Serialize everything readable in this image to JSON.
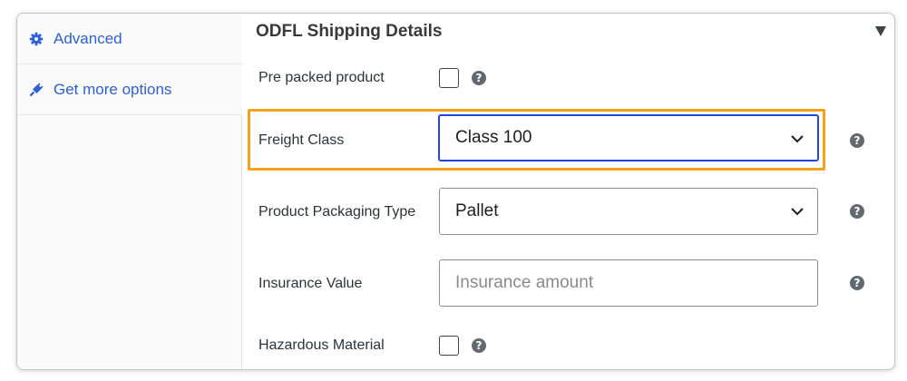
{
  "sidebar": {
    "items": [
      {
        "label": "Advanced",
        "icon": "gear-icon"
      },
      {
        "label": "Get more options",
        "icon": "plug-icon"
      }
    ]
  },
  "section": {
    "title": "ODFL Shipping Details"
  },
  "fields": {
    "pre_packed": {
      "label": "Pre packed product",
      "checked": false
    },
    "freight_class": {
      "label": "Freight Class",
      "value": "Class 100"
    },
    "packaging_type": {
      "label": "Product Packaging Type",
      "value": "Pallet"
    },
    "insurance_value": {
      "label": "Insurance Value",
      "placeholder": "Insurance amount",
      "value": ""
    },
    "hazardous": {
      "label": "Hazardous Material",
      "checked": false
    }
  },
  "help_glyph": "?",
  "colors": {
    "link": "#2c5fd8",
    "focus_border": "#2145e6",
    "highlight": "#f6a11a",
    "help_icon": "#646970"
  }
}
